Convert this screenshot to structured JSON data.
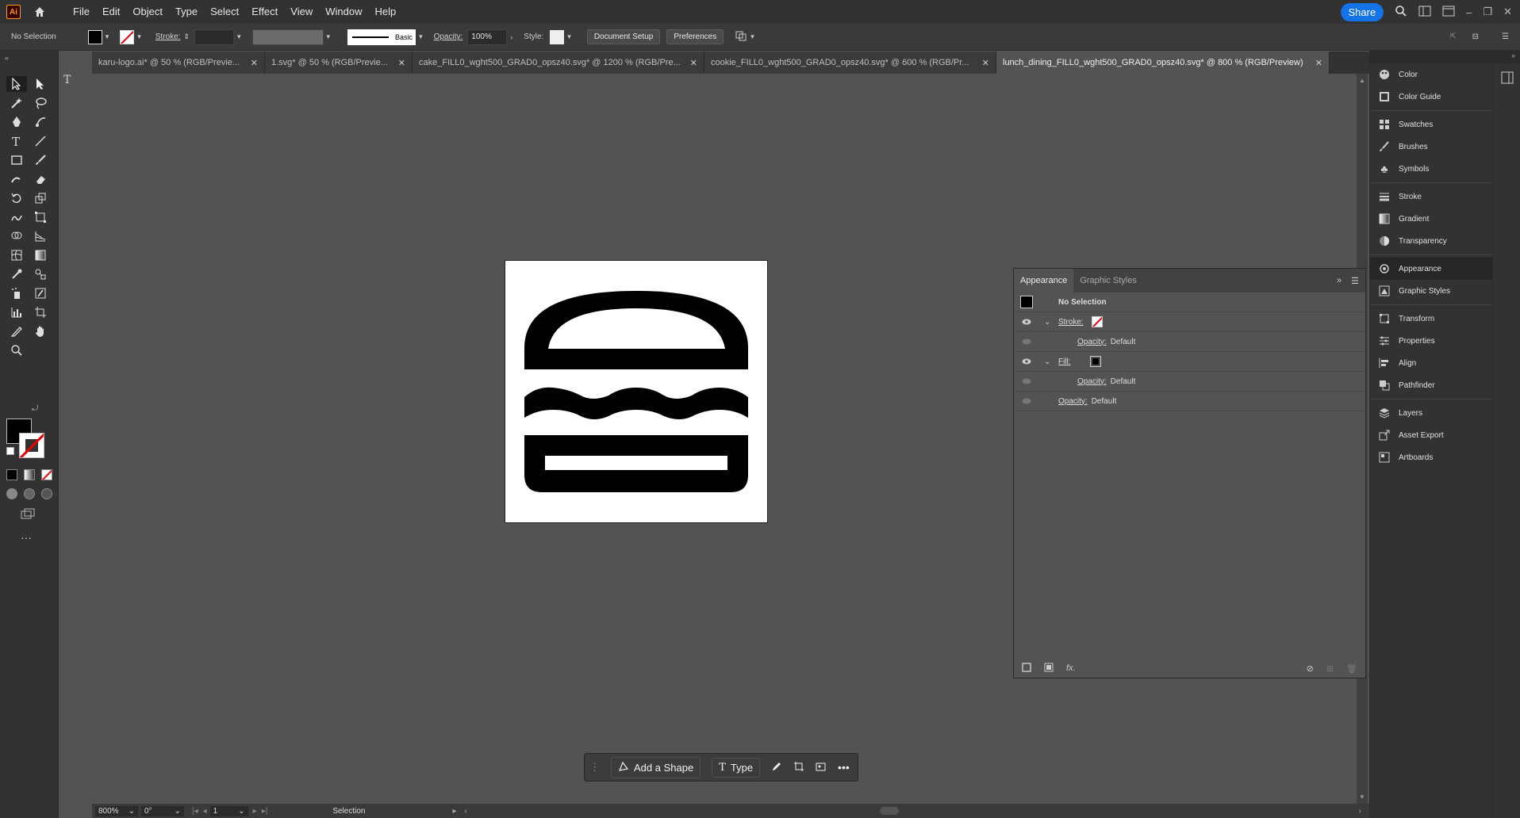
{
  "menubar": {
    "items": [
      "File",
      "Edit",
      "Object",
      "Type",
      "Select",
      "Effect",
      "View",
      "Window",
      "Help"
    ],
    "share_label": "Share"
  },
  "controlbar": {
    "selection_label": "No Selection",
    "stroke_label": "Stroke:",
    "brush_label": "Basic",
    "opacity_label": "Opacity:",
    "opacity_value": "100%",
    "style_label": "Style:",
    "document_setup": "Document Setup",
    "preferences": "Preferences"
  },
  "tabs": [
    {
      "title": "karu-logo.ai* @ 50 % (RGB/Previe..."
    },
    {
      "title": "1.svg* @ 50 % (RGB/Previe..."
    },
    {
      "title": "cake_FILL0_wght500_GRAD0_opsz40.svg* @ 1200 % (RGB/Pre..."
    },
    {
      "title": "cookie_FILL0_wght500_GRAD0_opsz40.svg* @ 600 % (RGB/Pr..."
    },
    {
      "title": "lunch_dining_FILL0_wght500_GRAD0_opsz40.svg* @ 800 % (RGB/Preview)"
    }
  ],
  "taskbar": {
    "add_shape": "Add a Shape",
    "type": "Type"
  },
  "status": {
    "zoom": "800%",
    "rotation": "0°",
    "artboard_index": "1",
    "tool": "Selection"
  },
  "appearance": {
    "tab_active": "Appearance",
    "tab_other": "Graphic Styles",
    "title": "No Selection",
    "stroke_label": "Stroke:",
    "fill_label": "Fill:",
    "opacity_label": "Opacity:",
    "default_value": "Default"
  },
  "dock": {
    "group1": [
      "Color",
      "Color Guide"
    ],
    "group2": [
      "Swatches",
      "Brushes",
      "Symbols"
    ],
    "group3": [
      "Stroke",
      "Gradient",
      "Transparency"
    ],
    "group4": [
      "Appearance",
      "Graphic Styles"
    ],
    "group5": [
      "Transform",
      "Properties",
      "Align",
      "Pathfinder"
    ],
    "group6": [
      "Layers",
      "Asset Export",
      "Artboards"
    ]
  },
  "colors": {
    "accent": "#1473e6",
    "app_bg": "#535353",
    "chrome": "#323232"
  }
}
